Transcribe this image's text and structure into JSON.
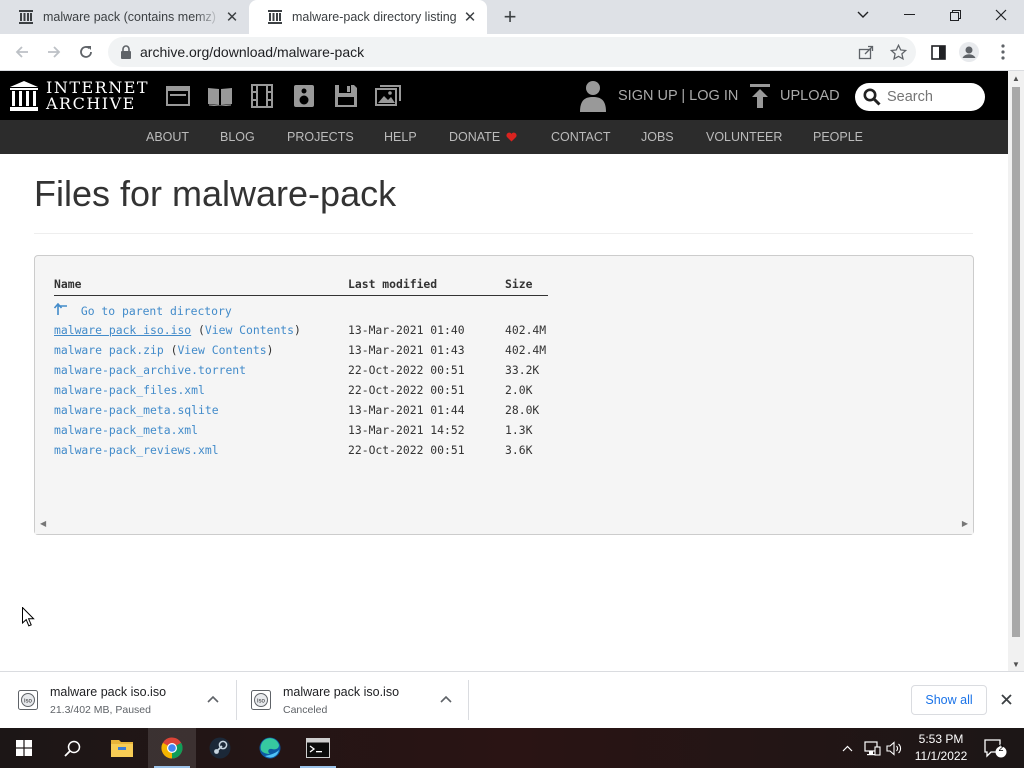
{
  "browser": {
    "tabs": [
      {
        "title": "malware pack (contains memz) : I",
        "active": false
      },
      {
        "title": "malware-pack directory listing",
        "active": true
      }
    ],
    "url": "archive.org/download/malware-pack"
  },
  "ia_header": {
    "logo_line1": "INTERNET",
    "logo_line2": "ARCHIVE",
    "media_icons": [
      "web-icon",
      "texts-icon",
      "video-icon",
      "audio-icon",
      "software-icon",
      "images-icon"
    ],
    "signup_login": "SIGN UP | LOG IN",
    "upload": "UPLOAD",
    "search_placeholder": "Search",
    "nav": [
      "ABOUT",
      "BLOG",
      "PROJECTS",
      "HELP",
      "DONATE",
      "CONTACT",
      "JOBS",
      "VOLUNTEER",
      "PEOPLE"
    ],
    "donate_heart_color": "#d9231f"
  },
  "page": {
    "title": "Files for malware-pack",
    "columns": {
      "name": "Name",
      "modified": "Last modified",
      "size": "Size"
    },
    "parent_link": "Go to parent directory",
    "files": [
      {
        "name": "malware pack iso.iso",
        "extra": "View Contents",
        "modified": "13-Mar-2021 01:40",
        "size": "402.4M"
      },
      {
        "name": "malware pack.zip",
        "extra": "View Contents",
        "modified": "13-Mar-2021 01:43",
        "size": "402.4M"
      },
      {
        "name": "malware-pack_archive.torrent",
        "extra": null,
        "modified": "22-Oct-2022 00:51",
        "size": "33.2K"
      },
      {
        "name": "malware-pack_files.xml",
        "extra": null,
        "modified": "22-Oct-2022 00:51",
        "size": "2.0K"
      },
      {
        "name": "malware-pack_meta.sqlite",
        "extra": null,
        "modified": "13-Mar-2021 01:44",
        "size": "28.0K"
      },
      {
        "name": "malware-pack_meta.xml",
        "extra": null,
        "modified": "13-Mar-2021 14:52",
        "size": "1.3K"
      },
      {
        "name": "malware-pack_reviews.xml",
        "extra": null,
        "modified": "22-Oct-2022 00:51",
        "size": "3.6K"
      }
    ]
  },
  "downloads": {
    "items": [
      {
        "name": "malware pack iso.iso",
        "status": "21.3/402 MB, Paused"
      },
      {
        "name": "malware pack iso.iso",
        "status": "Canceled"
      }
    ],
    "show_all": "Show all"
  },
  "taskbar": {
    "apps": [
      "start-icon",
      "search-icon",
      "file-explorer-icon",
      "chrome-icon",
      "steam-icon",
      "edge-icon",
      "terminal-icon"
    ],
    "time": "5:53 PM",
    "date": "11/1/2022",
    "notification_count": "2"
  },
  "colors": {
    "link": "#428bca",
    "ia_black": "#000000",
    "ia_nav": "#2c2c2c",
    "chrome_blue": "#1a73e8"
  }
}
